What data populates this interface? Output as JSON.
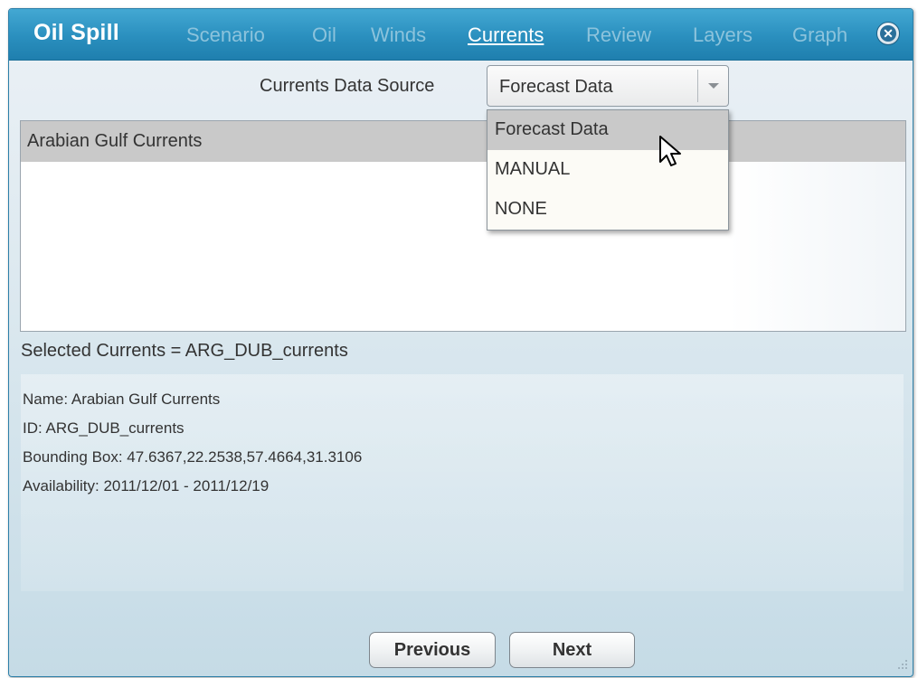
{
  "window": {
    "title": "Oil Spill",
    "tabs": [
      {
        "label": "Scenario",
        "active": false
      },
      {
        "label": "Oil",
        "active": false
      },
      {
        "label": "Winds",
        "active": false
      },
      {
        "label": "Currents",
        "active": true
      },
      {
        "label": "Review",
        "active": false
      },
      {
        "label": "Layers",
        "active": false
      },
      {
        "label": "Graph",
        "active": false
      }
    ],
    "close_icon": "close-circle-icon"
  },
  "currents": {
    "data_source_label": "Currents Data Source",
    "data_source_value": "Forecast Data",
    "dropdown_options": [
      "Forecast Data",
      "MANUAL",
      "NONE"
    ],
    "highlighted_option": "Forecast Data",
    "list_items": [
      "Arabian Gulf Currents"
    ],
    "selected_text": "Selected Currents = ARG_DUB_currents",
    "details": {
      "name": "Name: Arabian Gulf Currents",
      "id": "ID: ARG_DUB_currents",
      "bounding_box": "Bounding Box: 47.6367,22.2538,57.4664,31.3106",
      "availability": "Availability: 2011/12/01 - 2011/12/19"
    }
  },
  "footer": {
    "previous_label": "Previous",
    "next_label": "Next"
  },
  "colors": {
    "titlebar": "#2a8fbe",
    "active_tab": "#ffffff",
    "inactive_tab": "#8cc3dc",
    "selection": "#c9c9c9"
  }
}
